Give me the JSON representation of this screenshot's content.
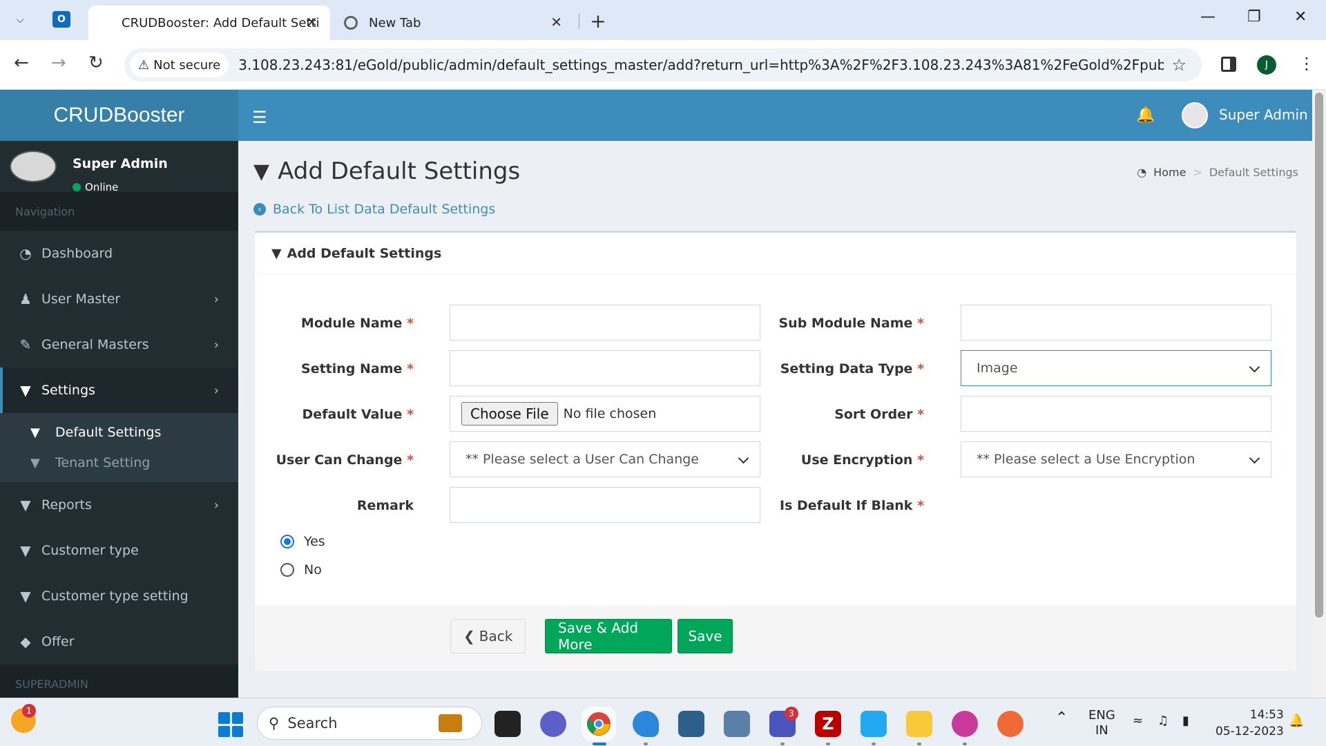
{
  "browser": {
    "tabs": [
      {
        "title": "CRUDBooster: Add Default Setti",
        "active": true
      },
      {
        "title": "New Tab",
        "active": false
      }
    ],
    "security_label": "Not secure",
    "url": "3.108.23.243:81/eGold/public/admin/default_settings_master/add?return_url=http%3A%2F%2F3.108.23.243%3A81%2FeGold%2Fpublic%2Fadm...",
    "profile_initial": "J"
  },
  "app": {
    "brand": "CRUDBooster",
    "top_user": "Super Admin"
  },
  "sidebar": {
    "user_name": "Super Admin",
    "user_status": "Online",
    "nav_header": "Navigation",
    "items": [
      {
        "label": "Dashboard",
        "icon": "dashboard-icon"
      },
      {
        "label": "User Master",
        "icon": "users-icon"
      },
      {
        "label": "General Masters",
        "icon": "pencil-icon"
      },
      {
        "label": "Settings",
        "icon": "filter-icon"
      },
      {
        "label": "Reports",
        "icon": "filter-icon"
      },
      {
        "label": "Customer type",
        "icon": "filter-icon"
      },
      {
        "label": "Customer type setting",
        "icon": "filter-icon"
      },
      {
        "label": "Offer",
        "icon": "tag-icon"
      }
    ],
    "subitems": [
      {
        "label": "Default Settings"
      },
      {
        "label": "Tenant Setting"
      }
    ],
    "superadmin_header": "SUPERADMIN"
  },
  "page": {
    "title": "Add Default Settings",
    "breadcrumb_home": "Home",
    "breadcrumb_current": "Default Settings",
    "back_link": "Back To List Data Default Settings",
    "box_title": "Add Default Settings"
  },
  "form": {
    "module_name": {
      "label": "Module Name",
      "value": ""
    },
    "sub_module_name": {
      "label": "Sub Module Name",
      "value": ""
    },
    "setting_name": {
      "label": "Setting Name",
      "value": ""
    },
    "setting_data_type": {
      "label": "Setting Data Type",
      "value": "Image"
    },
    "default_value": {
      "label": "Default Value",
      "button": "Choose File",
      "status": "No file chosen"
    },
    "sort_order": {
      "label": "Sort Order",
      "value": ""
    },
    "user_can_change": {
      "label": "User Can Change",
      "value": "** Please select a User Can Change"
    },
    "use_encryption": {
      "label": "Use Encryption",
      "value": "** Please select a Use Encryption"
    },
    "remark": {
      "label": "Remark",
      "value": ""
    },
    "is_default_if_blank": {
      "label": "Is Default If Blank",
      "options": [
        "Yes",
        "No"
      ],
      "selected": "Yes"
    },
    "required_mark": "*"
  },
  "buttons": {
    "back": "Back",
    "save_add_more": "Save & Add More",
    "save": "Save"
  },
  "taskbar": {
    "search_placeholder": "Search",
    "weather_badge": "1",
    "teams_badge": "3",
    "language": "ENG",
    "region": "IN",
    "time": "14:53",
    "date": "05-12-2023"
  },
  "colors": {
    "header_blue": "#3c8dbc",
    "logo_blue": "#367fa9",
    "sidebar_dark": "#222d32",
    "success_green": "#00a65a",
    "required_red": "#dd4b39"
  }
}
